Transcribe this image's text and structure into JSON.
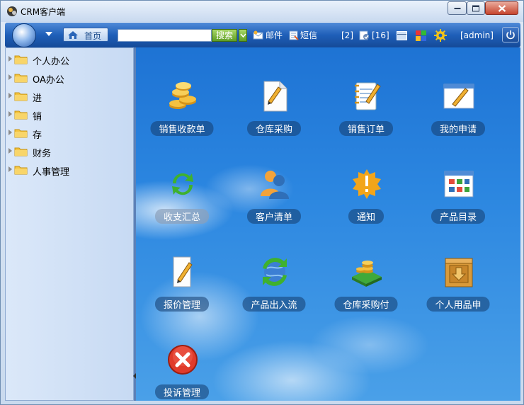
{
  "window": {
    "title": "CRM客户端"
  },
  "toolbar": {
    "home_label": "首页",
    "search_value": "",
    "search_label": "搜索",
    "mail_label": "邮件",
    "sms_label": "短信",
    "count_a": "[2]",
    "count_b": "[16]",
    "user": "[admin]"
  },
  "sidebar": {
    "items": [
      {
        "label": "个人办公"
      },
      {
        "label": "OA办公"
      },
      {
        "label": "进"
      },
      {
        "label": "销"
      },
      {
        "label": "存"
      },
      {
        "label": "财务"
      },
      {
        "label": "人事管理"
      }
    ]
  },
  "main": {
    "tiles": [
      {
        "label": "销售收款单",
        "icon": "coins-icon"
      },
      {
        "label": "仓库采购",
        "icon": "document-pencil-icon"
      },
      {
        "label": "销售订单",
        "icon": "notepad-icon"
      },
      {
        "label": "我的申请",
        "icon": "edit-window-icon"
      },
      {
        "label": "收支汇总",
        "icon": "refresh-arrows-icon"
      },
      {
        "label": "客户清单",
        "icon": "users-icon"
      },
      {
        "label": "通知",
        "icon": "alert-badge-icon"
      },
      {
        "label": "产品目录",
        "icon": "catalog-grid-icon"
      },
      {
        "label": "报价管理",
        "icon": "quote-document-icon"
      },
      {
        "label": "产品出入流",
        "icon": "globe-arrows-icon"
      },
      {
        "label": "仓库采购付",
        "icon": "money-stack-icon"
      },
      {
        "label": "个人用品申",
        "icon": "box-download-icon"
      },
      {
        "label": "投诉管理",
        "icon": "error-x-icon"
      }
    ]
  },
  "colors": {
    "accent": "#1f5fb8",
    "desktop": "#2b86e0",
    "search_green": "#5e9d24"
  }
}
